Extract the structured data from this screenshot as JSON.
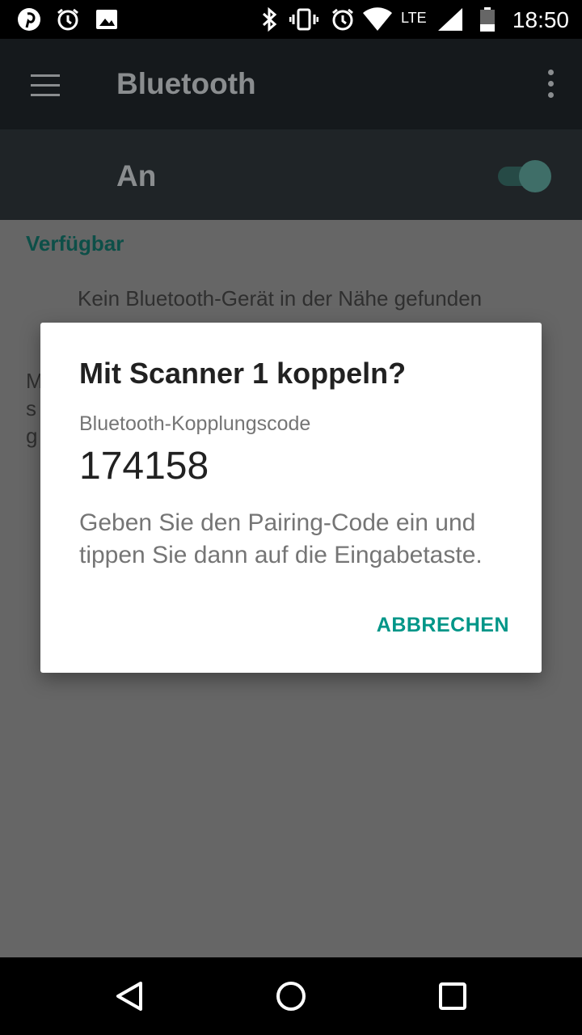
{
  "status_bar": {
    "time": "18:50",
    "network": "LTE",
    "left_icons": [
      "pinterest-icon",
      "alarm-icon",
      "image-icon"
    ],
    "right_icons": [
      "bluetooth-icon",
      "vibrate-icon",
      "alarm-icon",
      "wifi-icon",
      "signal-icon",
      "battery-icon"
    ]
  },
  "app_bar": {
    "title": "Bluetooth"
  },
  "switch_bar": {
    "label": "An",
    "enabled": true
  },
  "content": {
    "section_title": "Verfügbar",
    "empty_text": "Kein Bluetooth-Gerät in der Nähe gefunden"
  },
  "dialog": {
    "title": "Mit Scanner 1 koppeln?",
    "code_label": "Bluetooth-Kopplungscode",
    "code": "174158",
    "message": "Geben Sie den Pairing-Code ein und tippen Sie dann auf die Eingabetaste.",
    "cancel_label": "ABBRECHEN"
  },
  "colors": {
    "accent": "#009688",
    "dim_overlay": "#666666"
  }
}
